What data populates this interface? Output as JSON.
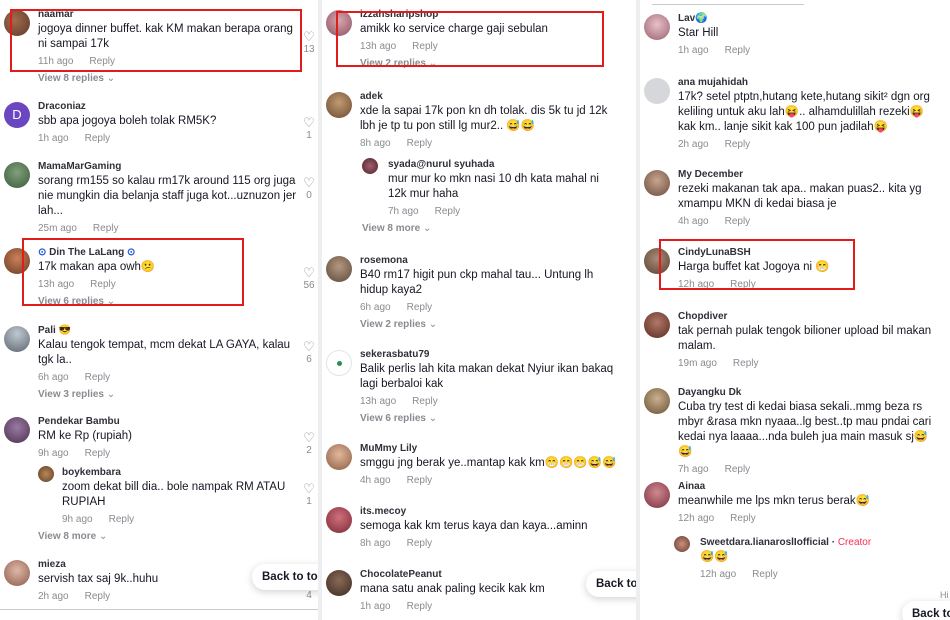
{
  "panel1": {
    "comments": [
      {
        "name": "naamar",
        "text": "jogoya dinner buffet. kak KM makan berapa orang ni sampai 17k",
        "time": "11h ago",
        "reply": "Reply",
        "more": "View 8 replies",
        "likes": "13"
      },
      {
        "name": "Draconiaz",
        "avatar_letter": "D",
        "text": "sbb apa jogoya boleh tolak RM5K?",
        "time": "1h ago",
        "reply": "Reply",
        "likes": "1"
      },
      {
        "name": "MamaMarGaming",
        "text": "sorang rm155 so kalau rm17k around 115 org juga nie mungkin dia belanja staff juga kot...uznuzon jer lah...",
        "time": "25m ago",
        "reply": "Reply",
        "likes": "0"
      },
      {
        "name": "Din The LaLang",
        "text": "17k makan apa owh😕",
        "time": "13h ago",
        "reply": "Reply",
        "more": "View 6 replies",
        "likes": "56"
      },
      {
        "name": "Pali 😎",
        "text": "Kalau tengok tempat, mcm dekat LA GAYA, kalau tgk la..",
        "time": "6h ago",
        "reply": "Reply",
        "more": "View 3 replies",
        "likes": "6"
      },
      {
        "name": "Pendekar Bambu",
        "text": "RM ke Rp (rupiah)",
        "time": "9h ago",
        "reply": "Reply",
        "likes": "2"
      },
      {
        "name": "boykembara",
        "text": "zoom dekat bill dia.. bole nampak RM ATAU RUPIAH",
        "time": "9h ago",
        "reply": "Reply",
        "more": "View 8 more",
        "likes": "1"
      },
      {
        "name": "mieza",
        "text": "servish tax saj 9k..huhu",
        "time": "2h ago",
        "reply": "Reply",
        "likes": "4"
      }
    ],
    "back_to_top": "Back to top"
  },
  "panel2": {
    "comments": [
      {
        "name": "izzahsharipshop",
        "text": "amikk ko service charge gaji sebulan",
        "time": "13h ago",
        "reply": "Reply",
        "more": "View 2 replies"
      },
      {
        "name": "adek",
        "text": "xde la sapai 17k pon kn dh tolak. dis 5k tu jd 12k lbh je tp tu pon still lg mur2.. 😅😅",
        "time": "8h ago",
        "reply": "Reply"
      },
      {
        "name": "syada@nurul syuhada",
        "text": "mur mur ko mkn nasi 10 dh kata mahal ni 12k mur haha",
        "time": "7h ago",
        "reply": "Reply",
        "more": "View 8 more"
      },
      {
        "name": "rosemona",
        "text": "B40 rm17 higit pun ckp mahal tau... Untung lh hidup kaya2",
        "time": "6h ago",
        "reply": "Reply",
        "more": "View 2 replies"
      },
      {
        "name": "sekerasbatu79",
        "text": "Balik perlis lah kita makan dekat Nyiur ikan bakaq lagi berbaloi kak",
        "time": "13h ago",
        "reply": "Reply",
        "more": "View 6 replies"
      },
      {
        "name": "MuMmy Lily",
        "text": "smggu jng berak ye..mantap kak km😁😁😁😅😅",
        "time": "4h ago",
        "reply": "Reply"
      },
      {
        "name": "its.mecoy",
        "text": "semoga kak km terus kaya dan kaya...aminn",
        "time": "8h ago",
        "reply": "Reply"
      },
      {
        "name": "ChocolatePeanut",
        "text": "mana satu anak paling kecik kak km",
        "time": "1h ago",
        "reply": "Reply"
      }
    ],
    "back_to_top": "Back to t"
  },
  "panel3": {
    "comments": [
      {
        "name": "Lav🌍",
        "text": "Star Hill",
        "time": "1h ago",
        "reply": "Reply"
      },
      {
        "name": "ana mujahidah",
        "text": "17k? setel ptptn,hutang kete,hutang sikit² dgn org keliling untuk aku lah😝.. alhamdulillah rezeki😝 kak km.. lanje sikit kak 100 pun jadilah😝",
        "time": "2h ago",
        "reply": "Reply"
      },
      {
        "name": "My December",
        "text": "rezeki makanan tak apa.. makan puas2.. kita yg xmampu MKN di kedai biasa je",
        "time": "4h ago",
        "reply": "Reply"
      },
      {
        "name": "CindyLunaBSH",
        "text": "Harga buffet kat Jogoya ni 😁",
        "time": "12h ago",
        "reply": "Reply"
      },
      {
        "name": "Chopdiver",
        "text": "tak pernah pulak tengok bilioner upload bil makan malam.",
        "time": "19m ago",
        "reply": "Reply"
      },
      {
        "name": "Dayangku Dk",
        "text": "Cuba try test di kedai biasa sekali..mmg beza rs mbyr &rasa mkn nyaaa..lg best..tp mau pndai cari kedai nya laaaa...nda buleh jua main masuk sj😅😅",
        "time": "7h ago",
        "reply": "Reply"
      },
      {
        "name": "Ainaa",
        "text": "meanwhile me lps mkn terus berak😅",
        "time": "12h ago",
        "reply": "Reply"
      },
      {
        "name": "Sweetdara.lianaroslIofficial",
        "creator": "Creator",
        "text": "😅😅",
        "time": "12h ago",
        "reply": "Reply"
      }
    ],
    "back_to_top": "Back to",
    "side_text": "Hi"
  }
}
